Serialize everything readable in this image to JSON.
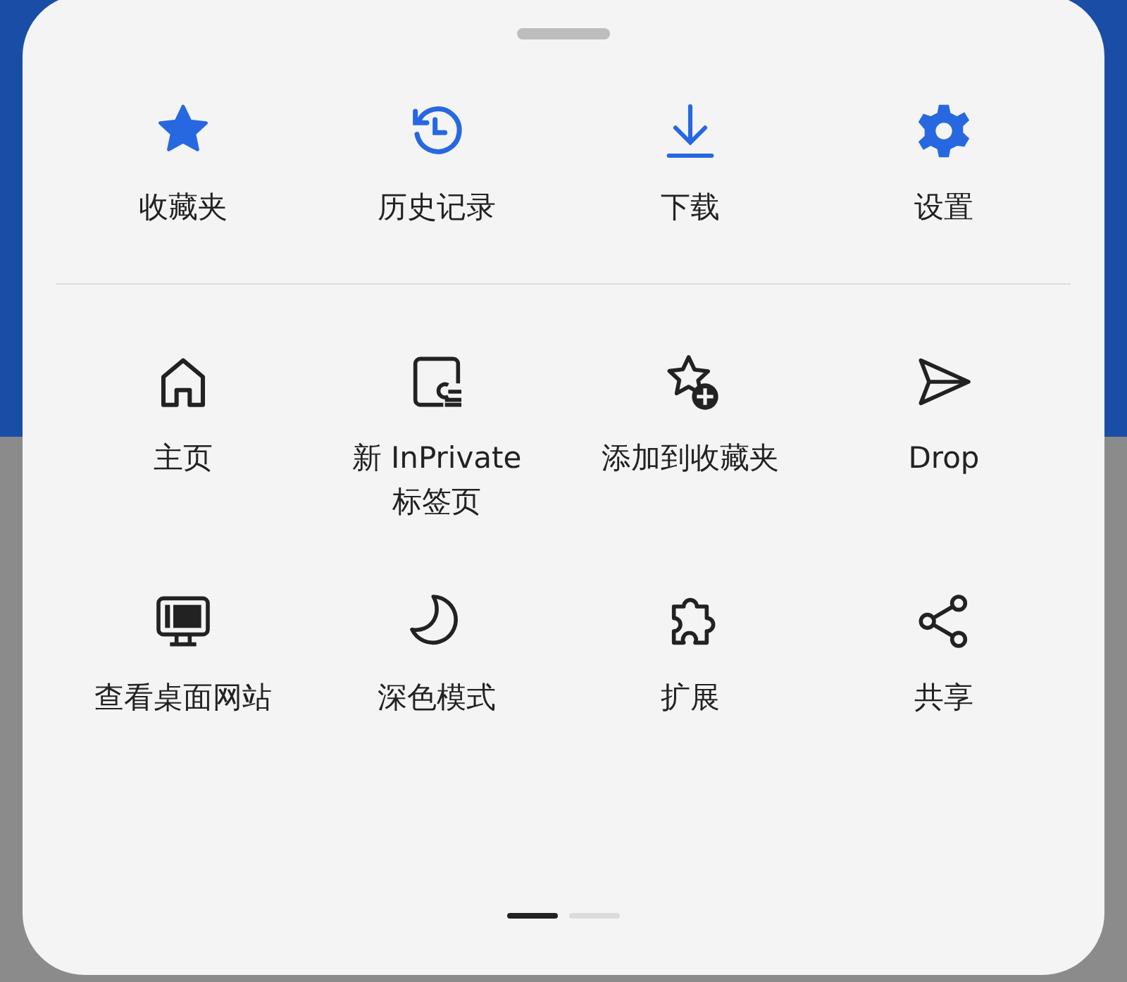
{
  "top_actions": [
    {
      "label": "收藏夹"
    },
    {
      "label": "历史记录"
    },
    {
      "label": "下载"
    },
    {
      "label": "设置"
    }
  ],
  "actions": [
    {
      "label": "主页"
    },
    {
      "label": "新 InPrivate\n标签页"
    },
    {
      "label": "添加到收藏夹"
    },
    {
      "label": "Drop"
    },
    {
      "label": "查看桌面网站"
    },
    {
      "label": "深色模式"
    },
    {
      "label": "扩展"
    },
    {
      "label": "共享"
    }
  ],
  "pages": [
    {
      "selected": true
    },
    {
      "selected": false
    }
  ]
}
